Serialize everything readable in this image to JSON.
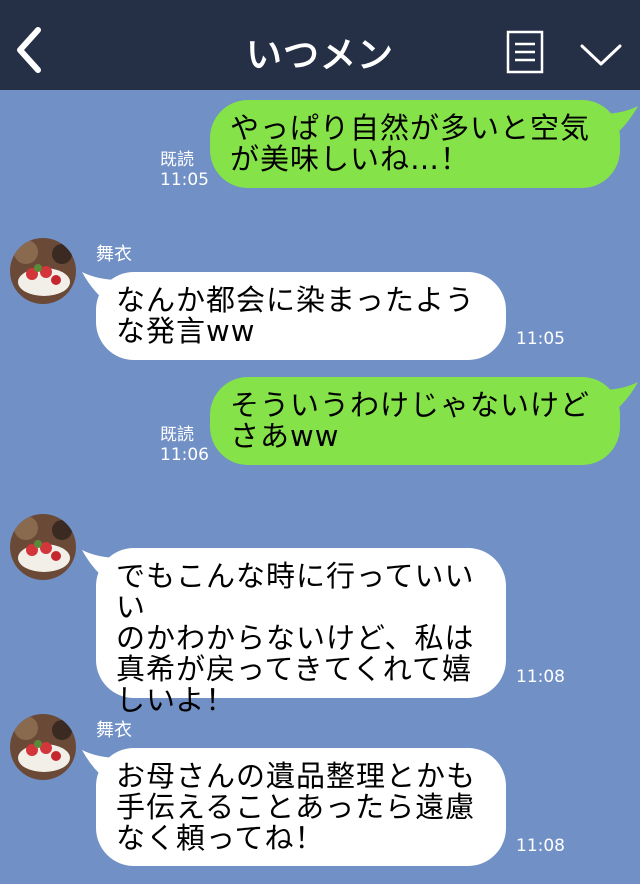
{
  "header": {
    "title": "いつメン",
    "back_icon": "chevron-left-icon",
    "menu_icon": "list-icon",
    "collapse_icon": "chevron-down-icon",
    "background": "#252f45"
  },
  "chat_background": "#7190c6",
  "colors": {
    "outgoing_bubble": "#85e249",
    "incoming_bubble": "#ffffff"
  },
  "messages": [
    {
      "direction": "out",
      "text": "やっぱり自然が多いと空気\nが美味しいね…！",
      "read_label": "既読",
      "time": "11:05"
    },
    {
      "direction": "in",
      "sender": "舞衣",
      "text": "なんか都会に染まったよう\nな発言ww",
      "time": "11:05"
    },
    {
      "direction": "out",
      "text": "そういうわけじゃないけど\nさあww",
      "read_label": "既読",
      "time": "11:06"
    },
    {
      "direction": "in",
      "sender": "",
      "text": "でもこんな時に行っていいい\nのかわからないけど、私は\n真希が戻ってきてくれて嬉\nしいよ！",
      "time": "11:08"
    },
    {
      "direction": "in",
      "sender": "舞衣",
      "text": "お母さんの遺品整理とかも\n手伝えることあったら遠慮\nなく頼ってね！",
      "time": "11:08"
    }
  ]
}
